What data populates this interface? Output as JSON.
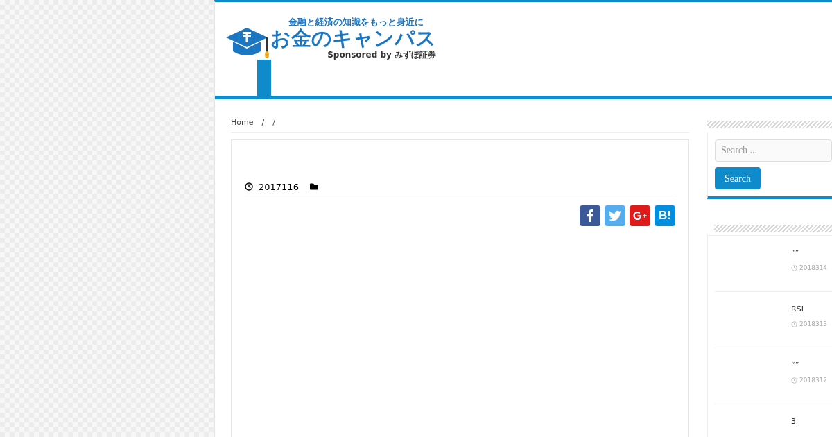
{
  "logo": {
    "tagline": "金融と経済の知識をもっと身近に",
    "name": "お金のキャンパス",
    "sponsor": "Sponsored by みずほ証券"
  },
  "nav_items": [
    {
      "selected": true
    }
  ],
  "breadcrumb": [
    "Home",
    "/",
    "/"
  ],
  "post": {
    "date": "2017116"
  },
  "share_buttons": [
    {
      "kind": "facebook"
    },
    {
      "kind": "twitter"
    },
    {
      "kind": "googleplus"
    },
    {
      "kind": "hatena",
      "label": "B!"
    }
  ],
  "search": {
    "placeholder": "Search ...",
    "button": "Search"
  },
  "recent_posts": [
    {
      "title": "“”",
      "date": "2018314"
    },
    {
      "title": "RSI",
      "date": "2018313"
    },
    {
      "title": "“”",
      "date": "2018312"
    },
    {
      "title": "3"
    }
  ]
}
